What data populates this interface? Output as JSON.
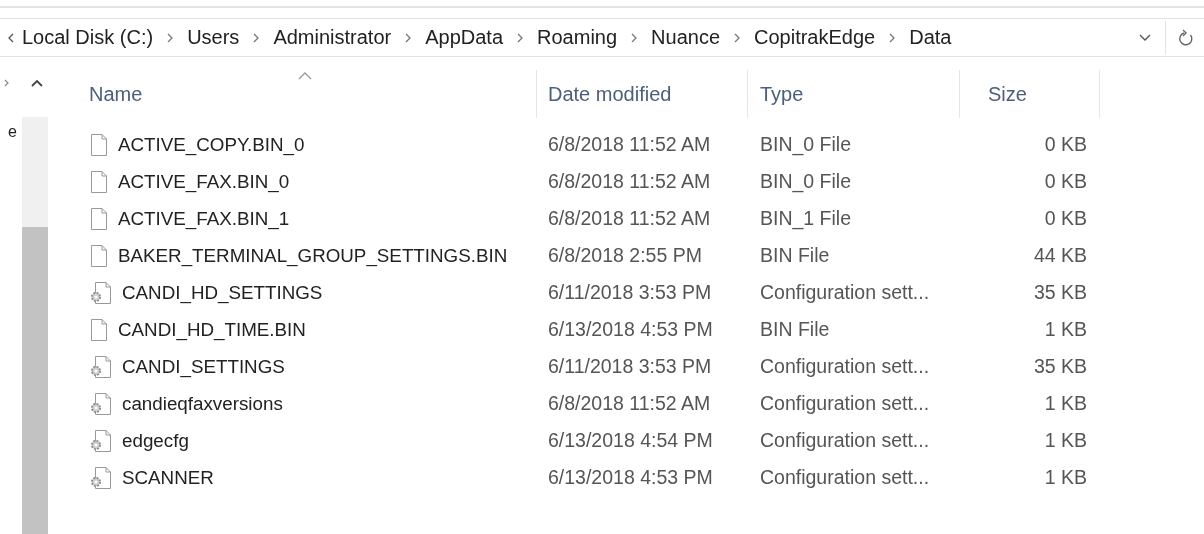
{
  "address_bar": {
    "breadcrumbs": [
      "Local Disk (C:)",
      "Users",
      "Administrator",
      "AppData",
      "Roaming",
      "Nuance",
      "CopitrakEdge",
      "Data"
    ]
  },
  "nav_pane": {
    "text": "e"
  },
  "table": {
    "columns": [
      {
        "label": "Name",
        "sorted": true
      },
      {
        "label": "Date modified",
        "sorted": false
      },
      {
        "label": "Type",
        "sorted": false
      },
      {
        "label": "Size",
        "sorted": false
      }
    ],
    "rows": [
      {
        "kind": "file",
        "name": "ACTIVE_COPY.BIN_0",
        "date": "6/8/2018 11:52 AM",
        "type": "BIN_0 File",
        "size": "0 KB"
      },
      {
        "kind": "file",
        "name": "ACTIVE_FAX.BIN_0",
        "date": "6/8/2018 11:52 AM",
        "type": "BIN_0 File",
        "size": "0 KB"
      },
      {
        "kind": "file",
        "name": "ACTIVE_FAX.BIN_1",
        "date": "6/8/2018 11:52 AM",
        "type": "BIN_1 File",
        "size": "0 KB"
      },
      {
        "kind": "file",
        "name": "BAKER_TERMINAL_GROUP_SETTINGS.BIN",
        "date": "6/8/2018 2:55 PM",
        "type": "BIN File",
        "size": "44 KB"
      },
      {
        "kind": "config",
        "name": "CANDI_HD_SETTINGS",
        "date": "6/11/2018 3:53 PM",
        "type": "Configuration sett...",
        "size": "35 KB"
      },
      {
        "kind": "file",
        "name": "CANDI_HD_TIME.BIN",
        "date": "6/13/2018 4:53 PM",
        "type": "BIN File",
        "size": "1 KB"
      },
      {
        "kind": "config",
        "name": "CANDI_SETTINGS",
        "date": "6/11/2018 3:53 PM",
        "type": "Configuration sett...",
        "size": "35 KB"
      },
      {
        "kind": "config",
        "name": "candieqfaxversions",
        "date": "6/8/2018 11:52 AM",
        "type": "Configuration sett...",
        "size": "1 KB"
      },
      {
        "kind": "config",
        "name": "edgecfg",
        "date": "6/13/2018 4:54 PM",
        "type": "Configuration sett...",
        "size": "1 KB"
      },
      {
        "kind": "config",
        "name": "SCANNER",
        "date": "6/13/2018 4:53 PM",
        "type": "Configuration sett...",
        "size": "1 KB"
      }
    ]
  }
}
